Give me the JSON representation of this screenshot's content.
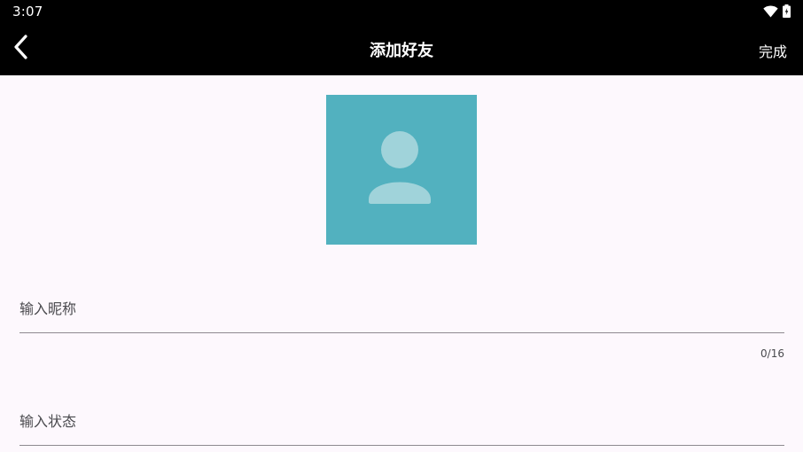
{
  "status_bar": {
    "time": "3:07",
    "icons": [
      "wifi-icon",
      "battery-icon"
    ]
  },
  "top_bar": {
    "title": "添加好友",
    "back_icon": "chevron-left-icon",
    "done_label": "完成"
  },
  "avatar": {
    "icon": "person-icon",
    "background": "#52B1BF",
    "figure_color": "#A0D3DA"
  },
  "form": {
    "nickname": {
      "value": "",
      "placeholder": "输入昵称",
      "counter": "0/16"
    },
    "status": {
      "value": "",
      "placeholder": "输入状态"
    }
  },
  "colors": {
    "bar_background": "#000000",
    "page_background": "#FDF8FD",
    "divider": "#8E8A90"
  }
}
